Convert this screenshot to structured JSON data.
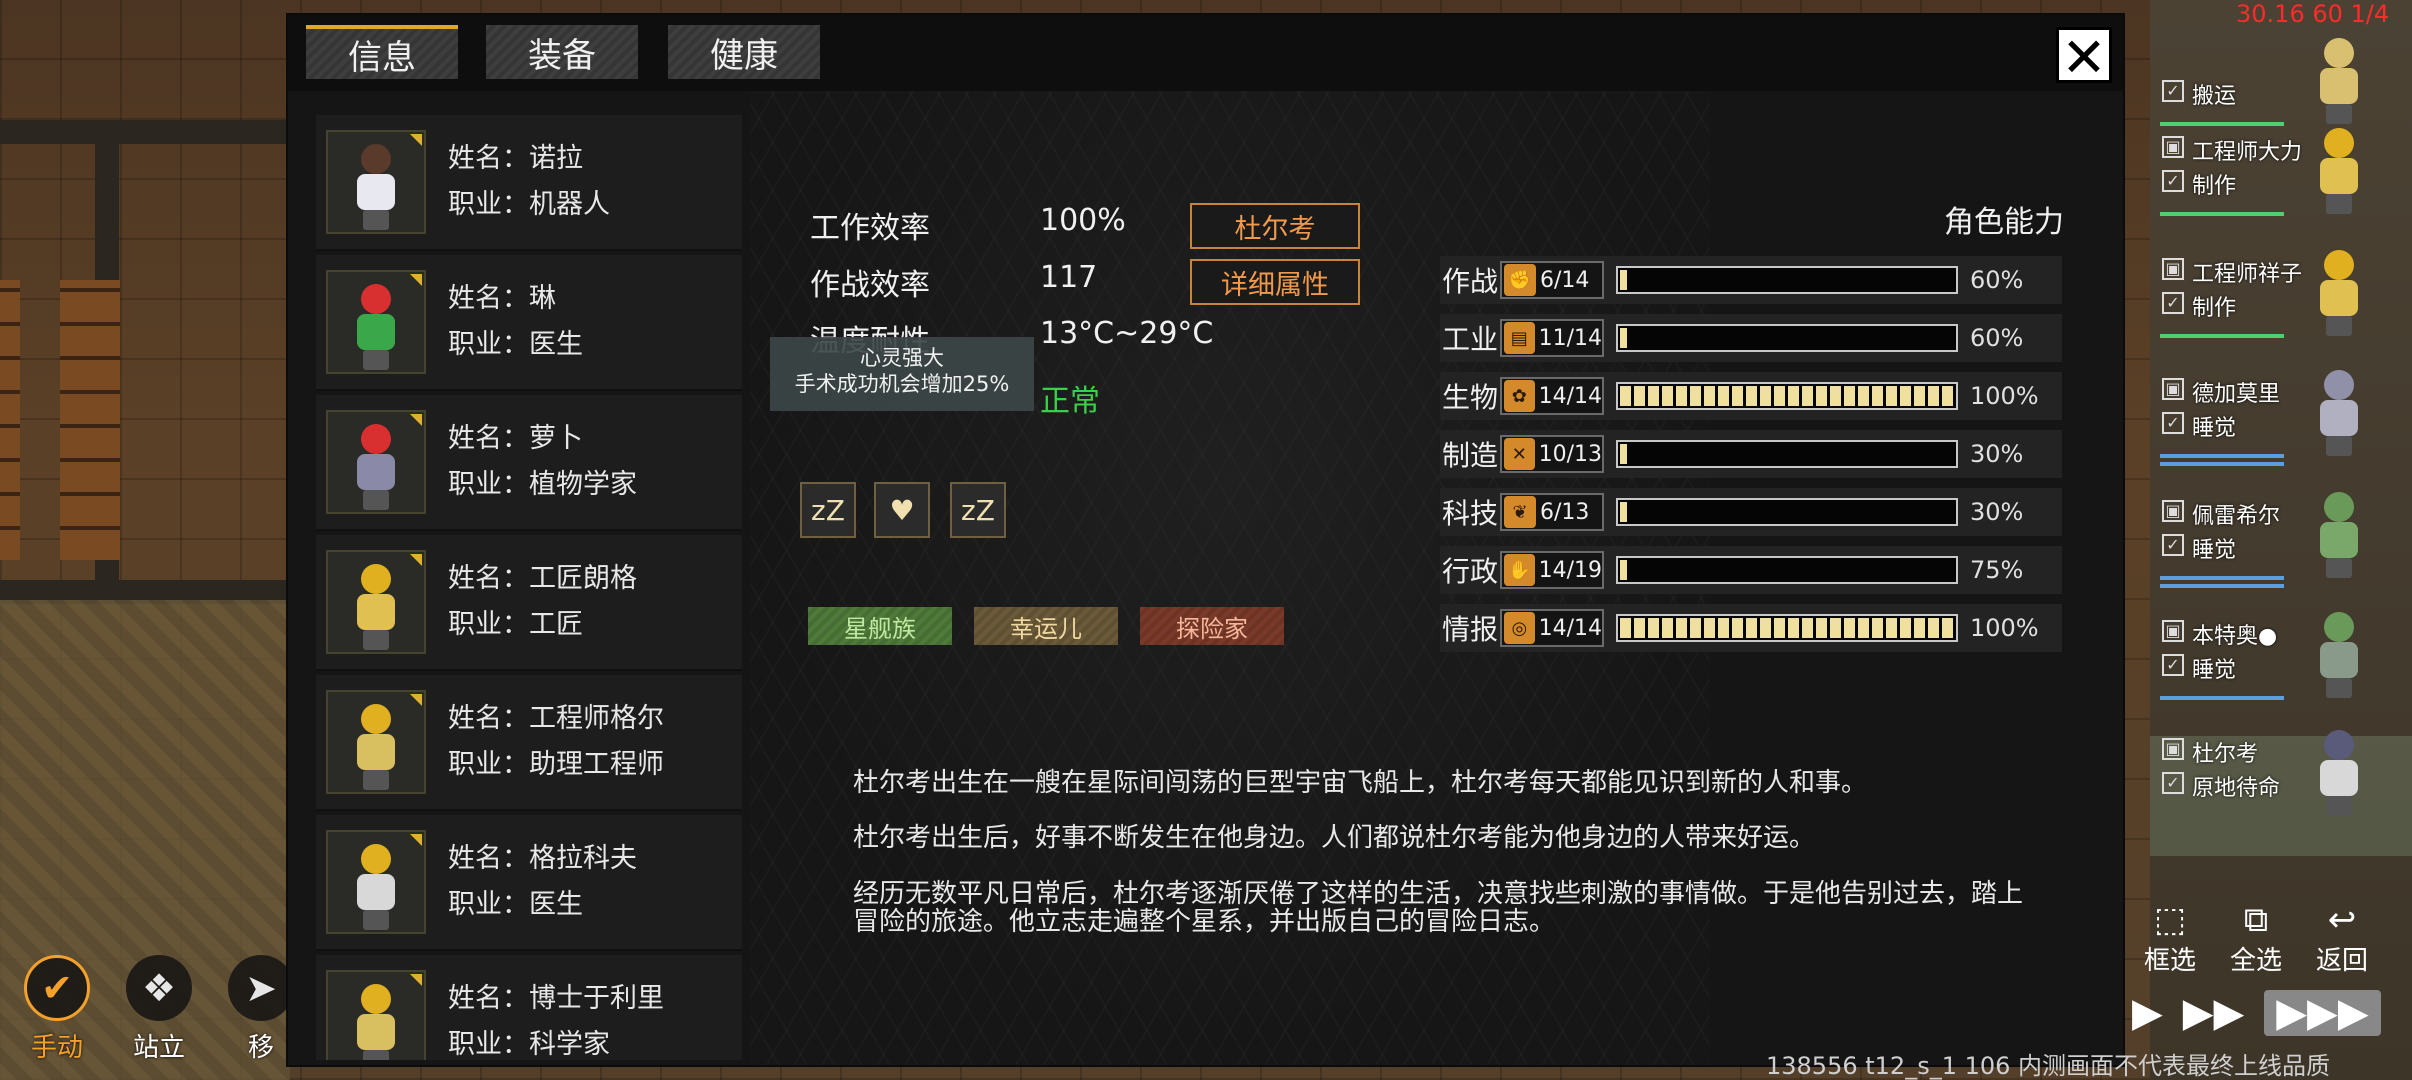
{
  "fps_counter": "30.16 60 1/4",
  "tabs": [
    {
      "label": "信息",
      "active": true
    },
    {
      "label": "装备",
      "active": false
    },
    {
      "label": "健康",
      "active": false
    }
  ],
  "close_icon": "close-icon",
  "characters": [
    {
      "name_prefix": "姓名：",
      "name": "诺拉",
      "job_prefix": "职业：",
      "job": "机器人",
      "colors": {
        "head": "#5a3a2a",
        "body": "#e8e8f0"
      }
    },
    {
      "name_prefix": "姓名：",
      "name": "琳",
      "job_prefix": "职业：",
      "job": "医生",
      "colors": {
        "head": "#d83030",
        "body": "#3aa84a"
      }
    },
    {
      "name_prefix": "姓名：",
      "name": "萝卜",
      "job_prefix": "职业：",
      "job": "植物学家",
      "colors": {
        "head": "#d83030",
        "body": "#8a8aa8"
      }
    },
    {
      "name_prefix": "姓名：",
      "name": "工匠朗格",
      "job_prefix": "职业：",
      "job": "工匠",
      "colors": {
        "head": "#e0b020",
        "body": "#e0c050"
      }
    },
    {
      "name_prefix": "姓名：",
      "name": "工程师格尔",
      "job_prefix": "职业：",
      "job": "助理工程师",
      "colors": {
        "head": "#e0b020",
        "body": "#d8c060"
      }
    },
    {
      "name_prefix": "姓名：",
      "name": "格拉科夫",
      "job_prefix": "职业：",
      "job": "医生",
      "colors": {
        "head": "#e0b020",
        "body": "#d8d8d8"
      }
    },
    {
      "name_prefix": "姓名：",
      "name": "博士于利里",
      "job_prefix": "职业：",
      "job": "科学家",
      "colors": {
        "head": "#e0b020",
        "body": "#d8c060"
      }
    }
  ],
  "stats": [
    {
      "label": "工作效率",
      "value": "100%"
    },
    {
      "label": "作战效率",
      "value": "117"
    },
    {
      "label": "温度耐性",
      "value": "13°C~29°C"
    },
    {
      "label": "",
      "value": "正常"
    }
  ],
  "buttons": {
    "character_name": "杜尔考",
    "detail_attributes": "详细属性"
  },
  "tooltip": {
    "line1": "心灵强大",
    "line2": "手术成功机会增加25%"
  },
  "status_icons": [
    "sleep-icon",
    "heart-plus-icon",
    "sleep-icon"
  ],
  "status_glyphs": [
    "zZ",
    "♥",
    "zZ"
  ],
  "traits": [
    {
      "label": "星舰族",
      "style": "green"
    },
    {
      "label": "幸运儿",
      "style": "gold"
    },
    {
      "label": "探险家",
      "style": "red"
    }
  ],
  "bio": [
    "杜尔考出生在一艘在星际间闯荡的巨型宇宙飞船上，杜尔考每天都能见识到新的人和事。",
    "杜尔考出生后，好事不断发生在他身边。人们都说杜尔考能为他身边的人带来好运。",
    "经历无数平凡日常后，杜尔考逐渐厌倦了这样的生活，决意找些刺激的事情做。于是他告别过去，踏上冒险的旅途。他立志走遍整个星系，并出版自己的冒险日志。"
  ],
  "abilities": {
    "title": "角色能力",
    "rows": [
      {
        "name": "作战",
        "icon": "arm-icon",
        "glyph": "✊",
        "value": "6/14",
        "percent": "60%",
        "fill": 0.02
      },
      {
        "name": "工业",
        "icon": "book-icon",
        "glyph": "▤",
        "value": "11/14",
        "percent": "60%",
        "fill": 0.02
      },
      {
        "name": "生物",
        "icon": "paw-icon",
        "glyph": "✿",
        "value": "14/14",
        "percent": "100%",
        "fill": 1.0
      },
      {
        "name": "制造",
        "icon": "tools-icon",
        "glyph": "✕",
        "value": "10/13",
        "percent": "30%",
        "fill": 0.02
      },
      {
        "name": "科技",
        "icon": "leaf-icon",
        "glyph": "❦",
        "value": "6/13",
        "percent": "30%",
        "fill": 0.02
      },
      {
        "name": "行政",
        "icon": "hand-icon",
        "glyph": "✋",
        "value": "14/19",
        "percent": "75%",
        "fill": 0.02
      },
      {
        "name": "情报",
        "icon": "target-icon",
        "glyph": "◎",
        "value": "14/14",
        "percent": "100%",
        "fill": 1.0
      }
    ]
  },
  "roster": [
    {
      "name": "",
      "job": "搬运",
      "bar": "green",
      "head": "#d8c070"
    },
    {
      "name": "工程师大力",
      "job": "制作",
      "bar": "green",
      "head": "#e0b020"
    },
    {
      "name": "工程师祥子",
      "job": "制作",
      "bar": "green",
      "head": "#e0b020"
    },
    {
      "name": "德加莫里",
      "job": "睡觉",
      "bar": "blue",
      "head": "#9090a8"
    },
    {
      "name": "佩雷希尔",
      "job": "睡觉",
      "bar": "blue",
      "head": "#6a9a5a"
    },
    {
      "name": "本特奥●",
      "job": "睡觉",
      "bar": "blue",
      "head": "#6a9a5a"
    },
    {
      "name": "杜尔考",
      "job": "原地待命",
      "bar": "none",
      "head": "#5a5a7a",
      "selected": true
    }
  ],
  "actions": [
    {
      "label": "手动",
      "icon": "manual-icon",
      "glyph": "✔",
      "active": true
    },
    {
      "label": "站立",
      "icon": "stand-icon",
      "glyph": "❖",
      "active": false
    },
    {
      "label": "移",
      "icon": "move-icon",
      "glyph": "➤",
      "active": false
    }
  ],
  "selection_buttons": [
    {
      "label": "框选",
      "glyph": "⬚"
    },
    {
      "label": "全选",
      "glyph": "⧉"
    },
    {
      "label": "返回",
      "glyph": "↩"
    }
  ],
  "speed_glyphs": [
    "▶",
    "▶▶",
    "▶▶▶"
  ],
  "footer": "138556 t12_s_1 106 内测画面不代表最终上线品质"
}
